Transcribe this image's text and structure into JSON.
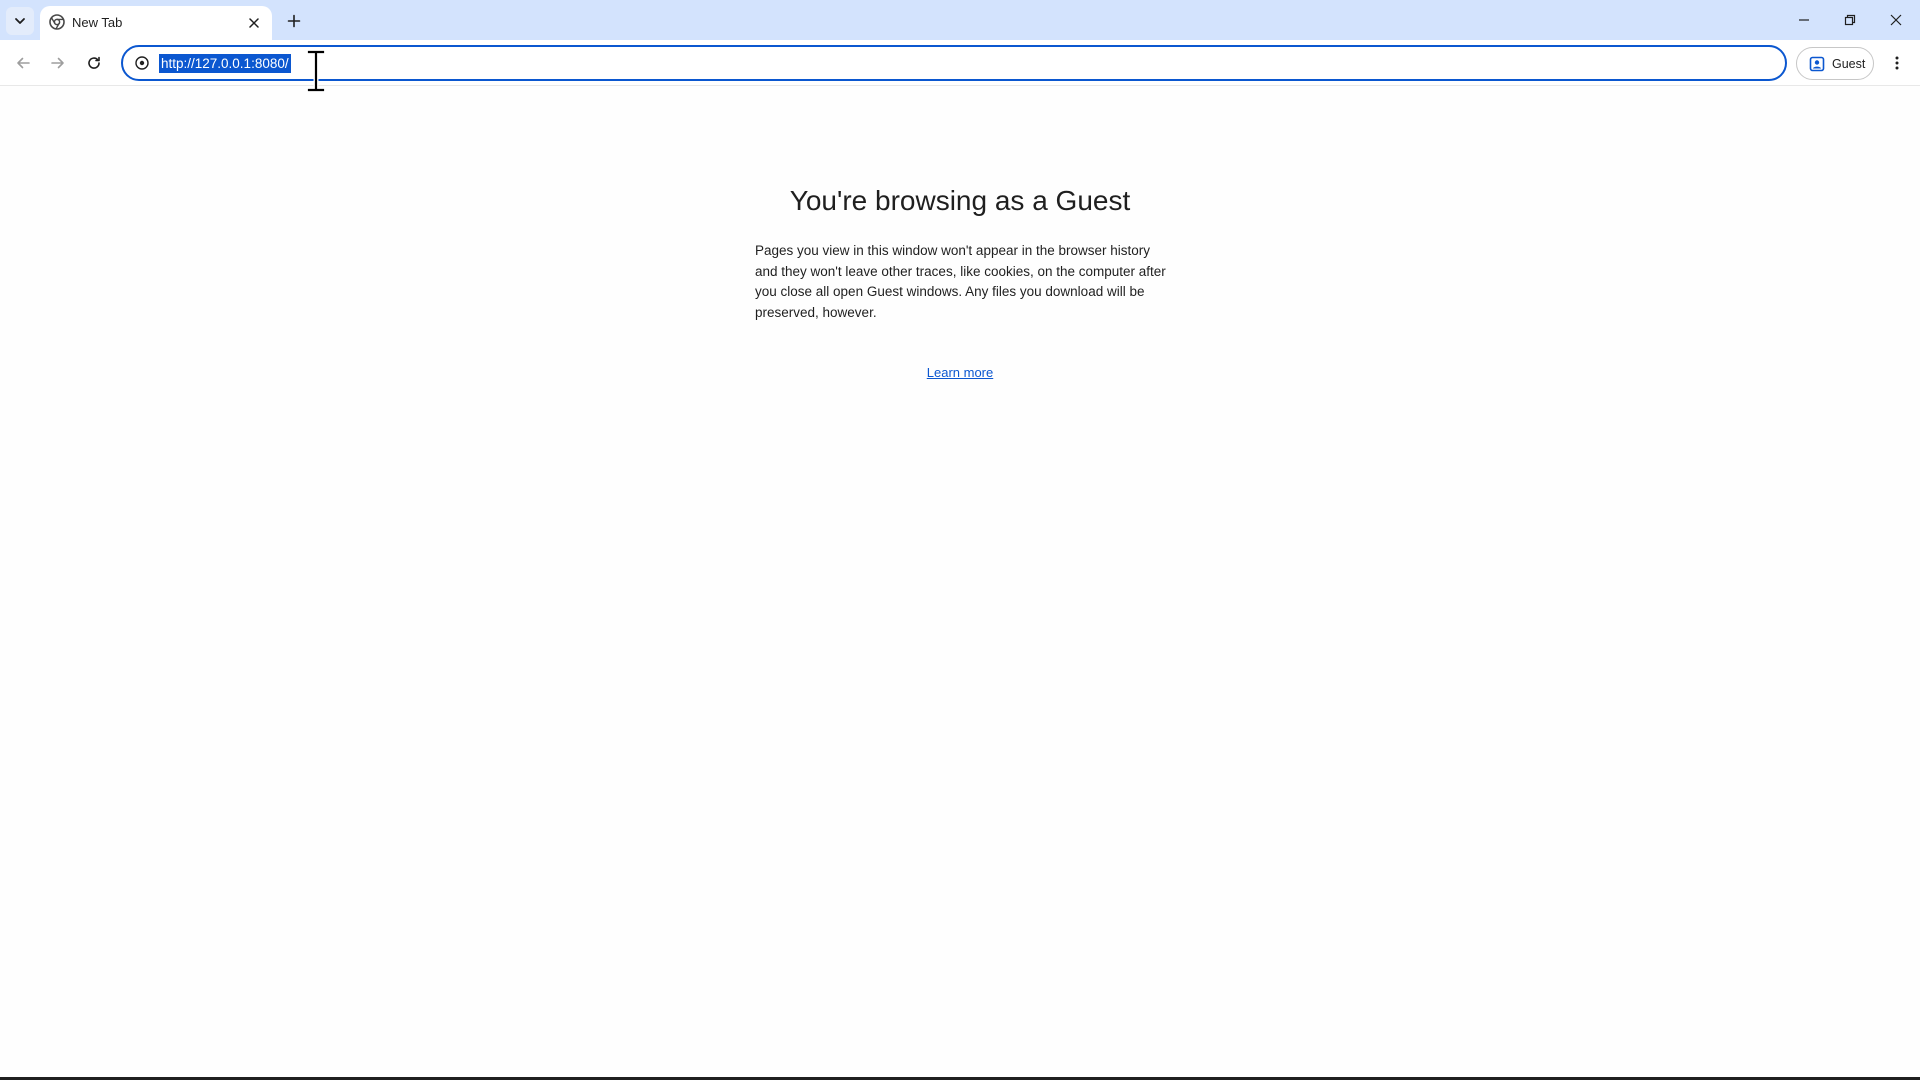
{
  "tab": {
    "title": "New Tab"
  },
  "toolbar": {
    "url": "http://127.0.0.1:8080/",
    "profile_label": "Guest"
  },
  "page": {
    "title": "You're browsing as a Guest",
    "description": "Pages you view in this window won't appear in the browser history and they won't leave other traces, like cookies, on the computer after you close all open Guest windows. Any files you download will be preserved, however.",
    "learn_more": "Learn more"
  },
  "colors": {
    "tabstrip_bg": "#d3e3fd",
    "accent": "#0b57d0",
    "page_bg": "#fefefe"
  },
  "icons": {
    "tab_search": "chevron-down-icon",
    "favicon": "chrome-icon",
    "tab_close": "close-icon",
    "new_tab": "plus-icon",
    "minimize": "minimize-icon",
    "restore": "restore-icon",
    "close_window": "close-icon",
    "back": "arrow-left-icon",
    "forward": "arrow-right-icon",
    "reload": "reload-icon",
    "site_info": "info-icon",
    "profile": "guest-profile-icon",
    "menu": "kebab-menu-icon",
    "cursor": "text-cursor-icon"
  }
}
